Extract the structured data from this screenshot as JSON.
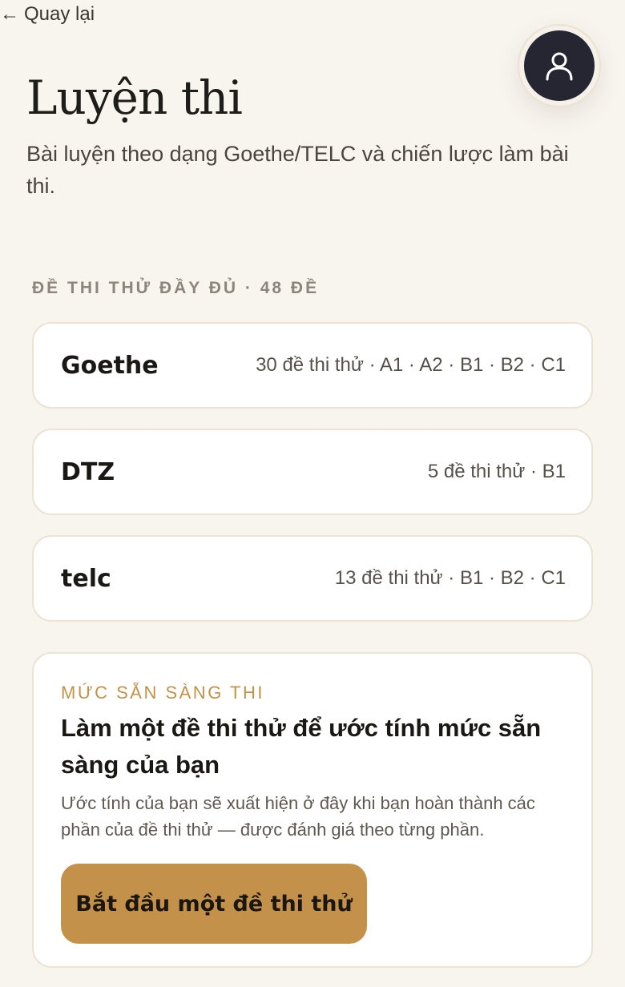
{
  "nav": {
    "back_arrow": "←",
    "back_label": "Quay lại"
  },
  "header": {
    "title": "Luyện thi",
    "subtitle": "Bài luyện theo dạng Goethe/TELC và chiến lược làm bài thi."
  },
  "section": {
    "label": "ĐỀ THI THỬ ĐẦY ĐỦ · 48 ĐỀ"
  },
  "exams": [
    {
      "name": "Goethe",
      "meta": "30 đề thi thử · A1 · A2 · B1 · B2 · C1"
    },
    {
      "name": "DTZ",
      "meta": "5 đề thi thử · B1"
    },
    {
      "name": "telc",
      "meta": "13 đề thi thử · B1 · B2 · C1"
    }
  ],
  "readiness": {
    "eyebrow": "MỨC SẴN SÀNG THI",
    "heading": "Làm một đề thi thử để ước tính mức sẵn sàng của bạn",
    "text": "Ước tính của bạn sẽ xuất hiện ở đây khi bạn hoàn thành các phần của đề thi thử — được đánh giá theo từng phần.",
    "button_label": "Bắt đầu một đề thi thử"
  },
  "icons": {
    "avatar": "user-icon",
    "back": "arrow-left-icon"
  },
  "colors": {
    "background": "#f8f5ef",
    "accent": "#c4914b",
    "avatar_bg": "#262633"
  }
}
